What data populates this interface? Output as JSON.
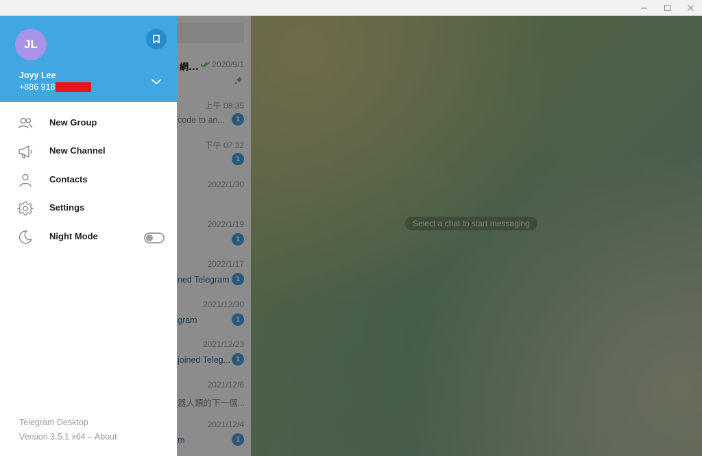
{
  "window": {
    "minimize": "—",
    "maximize": "☐",
    "close": "✕"
  },
  "user": {
    "initials": "JL",
    "name": "Joyy Lee",
    "phone": "+886 918"
  },
  "menu": [
    {
      "id": "new-group",
      "label": "New Group",
      "icon": "group-icon"
    },
    {
      "id": "new-channel",
      "label": "New Channel",
      "icon": "megaphone-icon"
    },
    {
      "id": "contacts",
      "label": "Contacts",
      "icon": "person-icon"
    },
    {
      "id": "settings",
      "label": "Settings",
      "icon": "gear-icon"
    },
    {
      "id": "night-mode",
      "label": "Night Mode",
      "icon": "moon-icon",
      "toggle": false
    }
  ],
  "footer": {
    "app_name": "Telegram Desktop",
    "version": "Version 3.5.1 x64 – About"
  },
  "chats": [
    {
      "title": "網...",
      "date": "2020/9/1",
      "preview": "",
      "unread": "",
      "pinned": true,
      "read_checks": true
    },
    {
      "title": "",
      "date": "上午 08:35",
      "preview": "code to an...",
      "unread": "1"
    },
    {
      "title": "",
      "date": "下午 07:32",
      "preview": "",
      "unread": "1"
    },
    {
      "title": "",
      "date": "2022/1/30",
      "preview": "",
      "unread": ""
    },
    {
      "title": "",
      "date": "2022/1/19",
      "preview": "",
      "unread": "1"
    },
    {
      "title": "",
      "date": "2022/1/17",
      "preview": "ned Telegram",
      "preview_blue": true,
      "unread": "1"
    },
    {
      "title": "",
      "date": "2021/12/30",
      "preview": "gram",
      "preview_blue": true,
      "unread": "1"
    },
    {
      "title": "",
      "date": "2021/12/23",
      "preview": "joined Teleg...",
      "preview_blue": true,
      "unread": "1"
    },
    {
      "title": "",
      "date": "2021/12/6",
      "preview": "器人類的下一個...",
      "unread": ""
    },
    {
      "title": "",
      "date": "2021/12/4",
      "preview": "m",
      "preview_blue": true,
      "unread": "1"
    }
  ],
  "chat_area": {
    "empty_message": "Select a chat to start messaging"
  },
  "colors": {
    "header": "#40a7e3",
    "avatar": "#a695e7",
    "redaction": "#e8141e"
  }
}
